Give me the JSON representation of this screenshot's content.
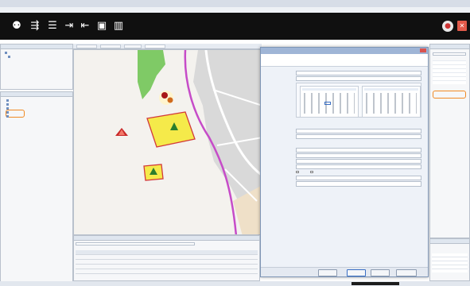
{
  "window": {
    "title": ""
  },
  "colors": {
    "toolbar_bg": "#101010",
    "road_magenta": "#c64cc8",
    "forest_green": "#7fca66",
    "restricted_fill": "#f5ea4a",
    "restricted_border": "#d23a3a",
    "hazard_red": "#c82828",
    "close_red": "#e05a4a",
    "selection_orange": "#f08a24"
  },
  "toolbar": {
    "icons": [
      "person-connected-icon",
      "route-icon",
      "database-icon",
      "import-icon",
      "export-icon",
      "document-settings-icon",
      "book-icon",
      "user-icon",
      "close-icon"
    ]
  },
  "dialog": {
    "title": "",
    "header": "",
    "fields": [
      {
        "label": "",
        "value": ""
      },
      {
        "label": "",
        "value": ""
      },
      {
        "label": "",
        "value": ""
      },
      {
        "label": "",
        "value": ""
      },
      {
        "label": "",
        "value": ""
      },
      {
        "label": "",
        "value": ""
      },
      {
        "label": "",
        "value": ""
      },
      {
        "label": "",
        "value": ""
      },
      {
        "label": "",
        "value": ""
      }
    ],
    "buttons": [
      {
        "label": ""
      },
      {
        "label": ""
      },
      {
        "label": ""
      },
      {
        "label": ""
      }
    ]
  }
}
